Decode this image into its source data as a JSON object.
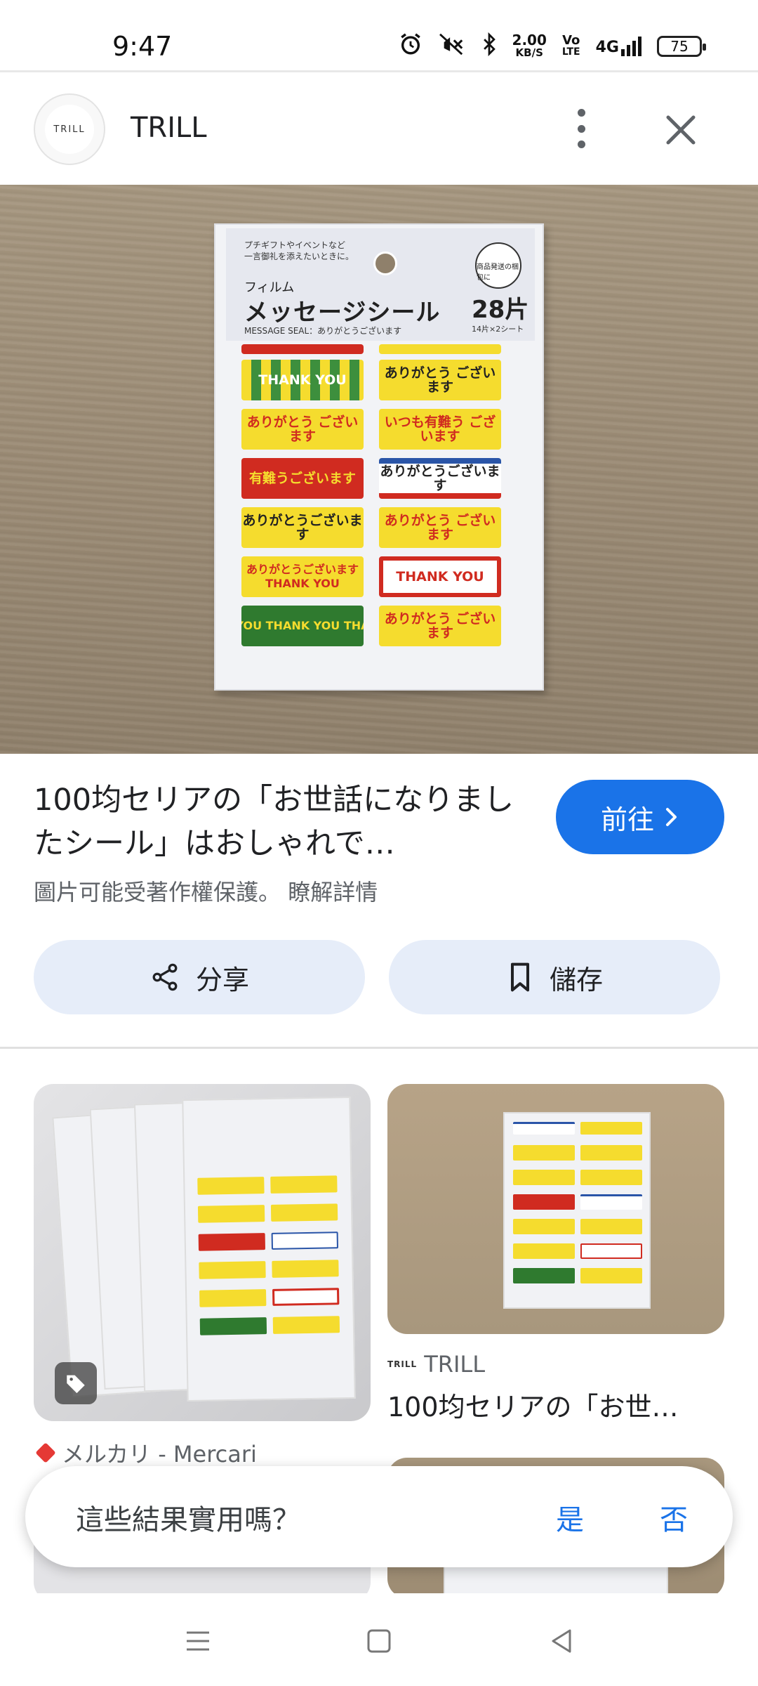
{
  "status_bar": {
    "time": "9:47",
    "speed_value": "2.00",
    "speed_unit": "KB/S",
    "volte_top": "Vo",
    "volte_bottom": "LTE",
    "network": "4G",
    "battery": "75"
  },
  "header": {
    "logo_text": "TRILL",
    "site_name": "TRILL"
  },
  "hero_image": {
    "pack_small_line1": "プチギフトやイベントなど",
    "pack_small_line2": "一言御礼を添えたいときに。",
    "pack_film": "フィルム",
    "pack_title": "メッセージシール",
    "pack_subtitle": "MESSAGE SEAL：ありがとうございます",
    "pack_badge": "商品発送の梱包に",
    "pack_count": "28片",
    "pack_count_sub": "14片×2シート",
    "stickers": {
      "s1": "THANK YOU",
      "s2": "ありがとう ございます",
      "s3": "ありがとう ございます",
      "s4": "いつも有難う ございます",
      "s5": "有難うございます",
      "s6": "ありがとうございます",
      "s7": "ありがとうございます",
      "s8": "ありがとう ございます",
      "s9": "ありがとうございます THANK YOU",
      "s10": "THANK YOU",
      "s11": "YOU  THANK YOU  THA",
      "s12": "ありがとう ございます"
    }
  },
  "result": {
    "title": "100均セリアの「お世話になりましたシール」はおしゃれで…",
    "visit_label": "前往",
    "copyright_notice": "圖片可能受著作權保護。",
    "learn_more": "瞭解詳情",
    "share_label": "分享",
    "save_label": "儲存"
  },
  "related": {
    "item1_source": "メルカリ - Mercari",
    "item2_source_logo": "TRILL",
    "item2_source": "TRILL",
    "item2_title": "100均セリアの「お世…"
  },
  "feedback": {
    "question": "這些結果實用嗎？",
    "yes": "是",
    "no": "否"
  },
  "colors": {
    "accent_blue": "#1a73e8",
    "chip_bg": "#e6edf9",
    "sticker_yellow": "#f5dc2e",
    "sticker_red": "#d02b20",
    "sticker_green": "#2f7a2f"
  }
}
